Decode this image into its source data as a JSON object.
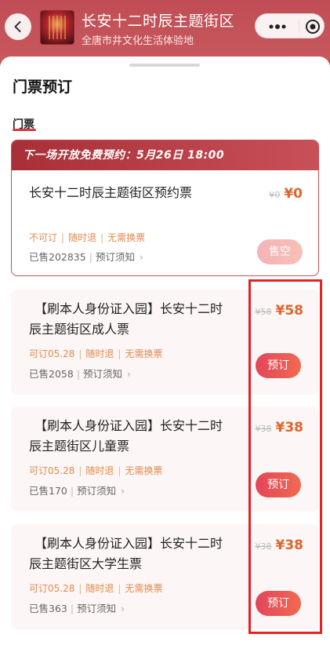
{
  "header": {
    "title": "长安十二时辰主题街区",
    "subtitle": "全唐市井文化生活体验地"
  },
  "icons": {
    "back": "chevron-left-icon",
    "more": "more-dots-icon",
    "target": "target-circle-icon"
  },
  "page": {
    "section_title": "门票预订",
    "sub_title": "门票"
  },
  "free_ticket": {
    "banner": "下一场开放免费预约：5月26日 18:00",
    "name": "长安十二时辰主题街区预约票",
    "orig_price": "¥0",
    "price": "¥0",
    "tags": [
      "不可订",
      "随时退",
      "无需换票"
    ],
    "sold": "已售202835",
    "notice": "预订须知",
    "button": "售空"
  },
  "tickets": [
    {
      "name_line1": "【刷本人身份证入园】长安十二时",
      "name_line2": "辰主题街区成人票",
      "orig_price": "¥58",
      "price": "¥58",
      "tags": [
        "可订05.28",
        "随时退",
        "无需换票"
      ],
      "sold": "已售2058",
      "notice": "预订须知",
      "button": "预订"
    },
    {
      "name_line1": "【刷本人身份证入园】长安十二时",
      "name_line2": "辰主题街区儿童票",
      "orig_price": "¥38",
      "price": "¥38",
      "tags": [
        "可订05.28",
        "随时退",
        "无需换票"
      ],
      "sold": "已售170",
      "notice": "预订须知",
      "button": "预订"
    },
    {
      "name_line1": "【刷本人身份证入园】长安十二时",
      "name_line2": "辰主题街区大学生票",
      "orig_price": "¥38",
      "price": "¥38",
      "tags": [
        "可订05.28",
        "随时退",
        "无需换票"
      ],
      "sold": "已售363",
      "notice": "预订须知",
      "button": "预订"
    }
  ],
  "colors": {
    "header_bg": "#c24f56",
    "accent": "#e0642c",
    "button": "#e3455b",
    "highlight": "#e52323"
  }
}
